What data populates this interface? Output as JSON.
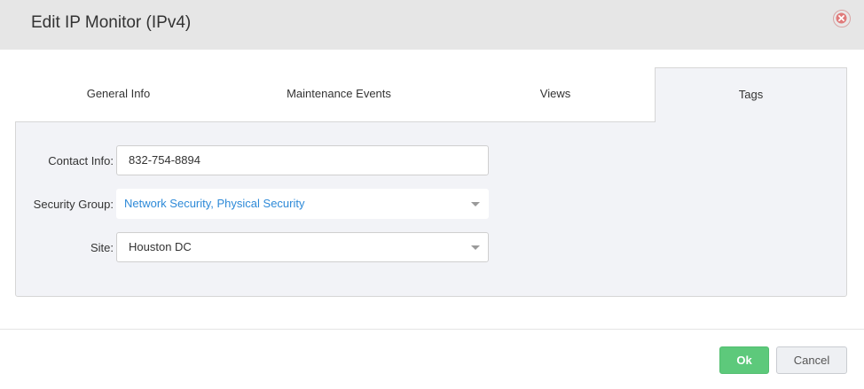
{
  "dialog": {
    "title": "Edit IP Monitor (IPv4)"
  },
  "tabs": [
    {
      "label": "General Info",
      "active": false
    },
    {
      "label": "Maintenance Events",
      "active": false
    },
    {
      "label": "Views",
      "active": false
    },
    {
      "label": "Tags",
      "active": true
    }
  ],
  "form": {
    "contact_info": {
      "label": "Contact Info:",
      "value": "832-754-8894"
    },
    "security_group": {
      "label": "Security Group:",
      "value": "Network Security, Physical Security"
    },
    "site": {
      "label": "Site:",
      "value": "Houston DC"
    }
  },
  "footer": {
    "ok_label": "Ok",
    "cancel_label": "Cancel"
  },
  "colors": {
    "ok_button": "#5dc97b",
    "link_text": "#2e8ad8",
    "close_icon": "#d9534f"
  }
}
